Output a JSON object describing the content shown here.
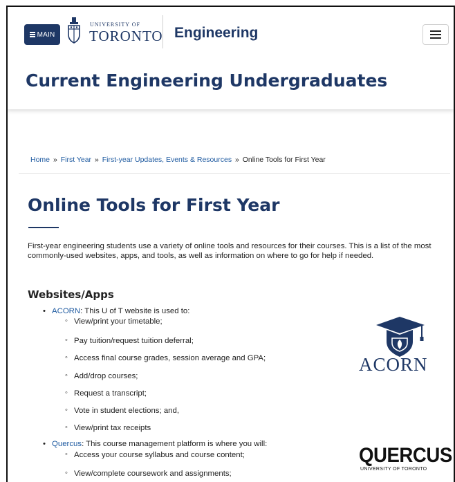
{
  "header": {
    "main_button_label": "MAIN",
    "uoft_top": "UNIVERSITY OF",
    "uoft_main": "TORONTO",
    "faculty": "Engineering",
    "site_title": "Current Engineering Undergraduates"
  },
  "breadcrumb": {
    "items": [
      "Home",
      "First Year",
      "First-year Updates, Events & Resources"
    ],
    "separator": "»",
    "current": "Online Tools for First Year"
  },
  "page": {
    "title": "Online Tools for First Year",
    "intro": "First-year engineering students use a variety of online tools and resources for their courses. This is a list of the most commonly-used websites, apps, and tools, as well as information on where to go for help if needed.",
    "section_heading": "Websites/Apps"
  },
  "tools": [
    {
      "name": "ACORN",
      "description": ": This U of T website is used to:",
      "items": [
        "View/print your timetable;",
        "Pay tuition/request tuition deferral;",
        "Access final course grades, session average and GPA;",
        "Add/drop courses;",
        "Request a transcript;",
        "Vote in student elections; and,",
        "View/print tax receipts"
      ]
    },
    {
      "name": "Quercus",
      "description": ": This course management platform is where you will:",
      "items": [
        "Access your course syllabus and course content;",
        "View/complete coursework and assignments;"
      ]
    }
  ],
  "logos": {
    "acorn": "ACORN",
    "quercus": "QUERCUS",
    "quercus_sub": "UNIVERSITY OF TORONTO"
  },
  "colors": {
    "brand_navy": "#1e3765",
    "link": "#1e5aa0"
  },
  "icons": [
    "hamburger-icon",
    "menu-icon",
    "uoft-crest-icon",
    "graduation-cap-icon"
  ]
}
